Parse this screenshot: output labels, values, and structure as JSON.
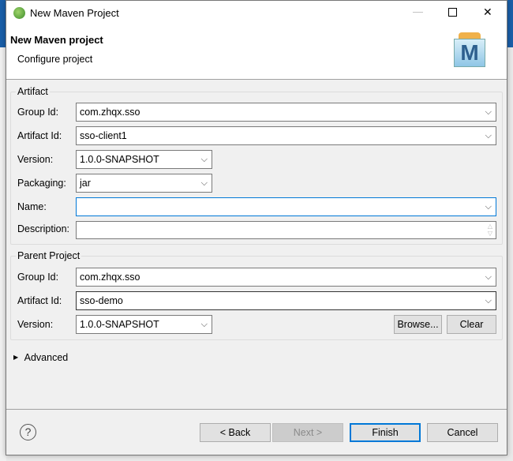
{
  "window": {
    "title": "New Maven Project",
    "minimize": "—",
    "maximize": "☐",
    "close": "✕"
  },
  "header": {
    "title": "New Maven project",
    "subtitle": "Configure project",
    "logo_letter": "M"
  },
  "artifact": {
    "legend": "Artifact",
    "group_id": {
      "label": "Group Id:",
      "value": "com.zhqx.sso"
    },
    "artifact_id": {
      "label": "Artifact Id:",
      "value": "sso-client1"
    },
    "version": {
      "label": "Version:",
      "value": "1.0.0-SNAPSHOT"
    },
    "packaging": {
      "label": "Packaging:",
      "value": "jar"
    },
    "name": {
      "label": "Name:",
      "value": ""
    },
    "description": {
      "label": "Description:",
      "value": ""
    }
  },
  "parent": {
    "legend": "Parent Project",
    "group_id": {
      "label": "Group Id:",
      "value": "com.zhqx.sso"
    },
    "artifact_id": {
      "label": "Artifact Id:",
      "value": "sso-demo"
    },
    "version": {
      "label": "Version:",
      "value": "1.0.0-SNAPSHOT"
    },
    "browse": "Browse...",
    "clear": "Clear"
  },
  "advanced": {
    "label": "Advanced"
  },
  "footer": {
    "help": "?",
    "back": "< Back",
    "next": "Next >",
    "finish": "Finish",
    "cancel": "Cancel"
  },
  "colors": {
    "accent": "#0078d7"
  }
}
